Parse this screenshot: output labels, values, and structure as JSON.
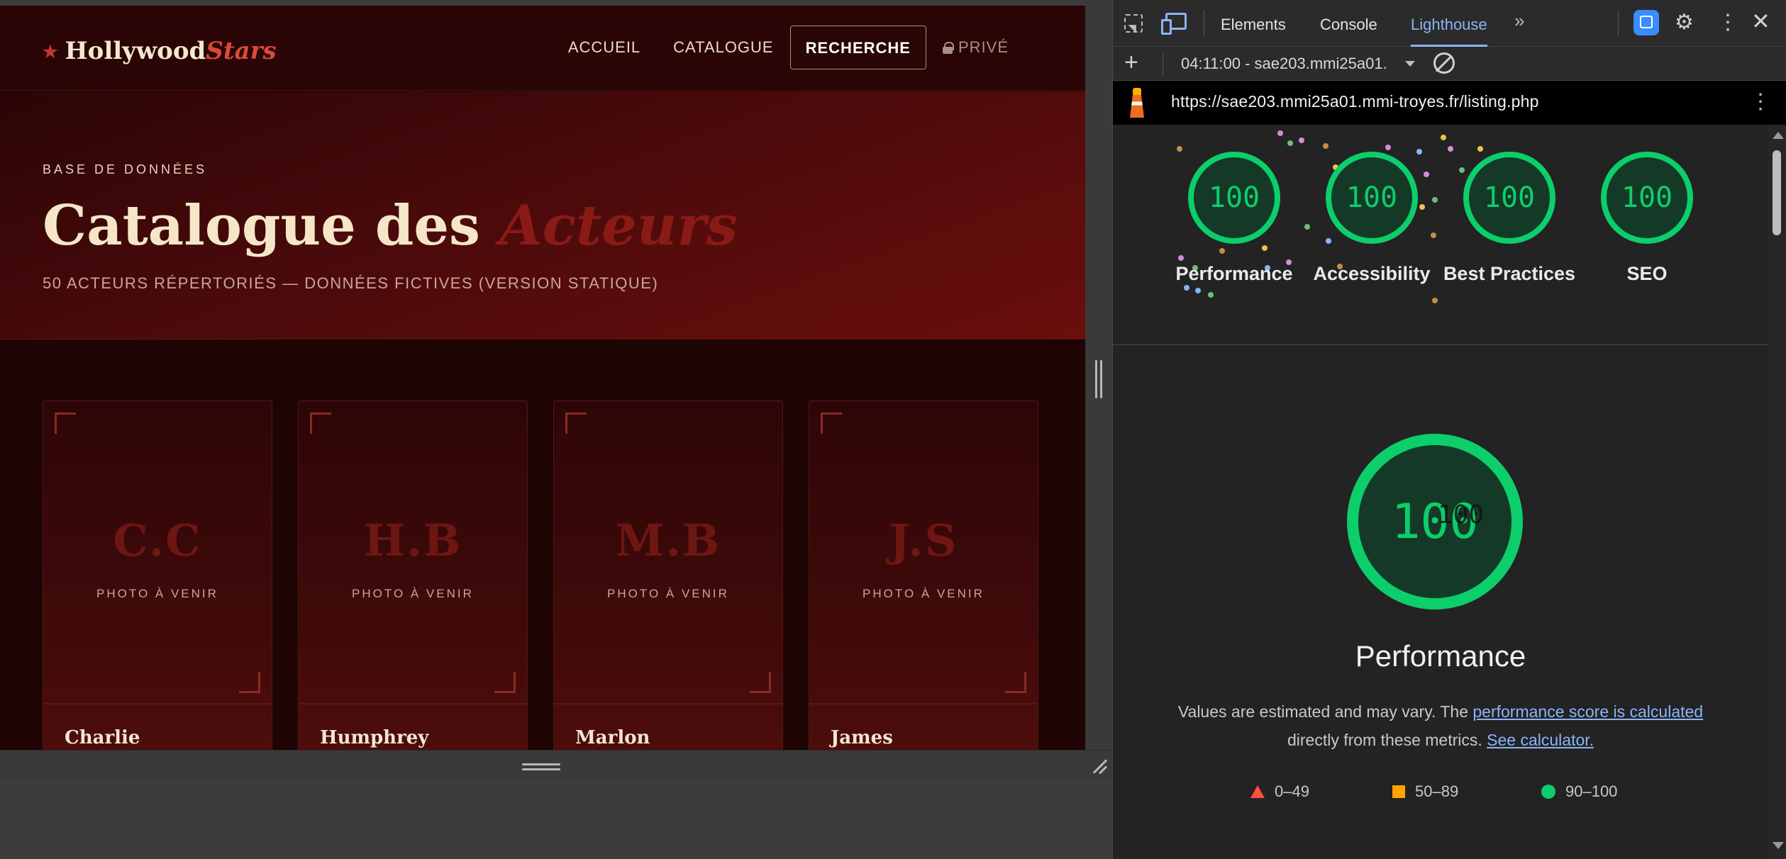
{
  "site": {
    "logo": {
      "main": "Hollywood",
      "accent": "Stars"
    },
    "nav": [
      "ACCUEIL",
      "CATALOGUE",
      "RECHERCHE",
      "PRIVÉ"
    ],
    "hero": {
      "kicker": "BASE DE DONNÉES",
      "title": "Catalogue des",
      "title_accent": "Acteurs",
      "subtitle": "50 ACTEURS RÉPERTORIÉS — DONNÉES FICTIVES (VERSION STATIQUE)"
    },
    "cards": [
      {
        "initials": "C.C",
        "photo": "PHOTO À VENIR",
        "name": "Charlie"
      },
      {
        "initials": "H.B",
        "photo": "PHOTO À VENIR",
        "name": "Humphrey"
      },
      {
        "initials": "M.B",
        "photo": "PHOTO À VENIR",
        "name": "Marlon"
      },
      {
        "initials": "J.S",
        "photo": "PHOTO À VENIR",
        "name": "James"
      }
    ]
  },
  "devtools": {
    "tabs": [
      "Elements",
      "Console",
      "Lighthouse"
    ],
    "report_selector": "04:11:00 - sae203.mmi25a01.",
    "url": "https://sae203.mmi25a01.mmi-troyes.fr/listing.php",
    "scores": [
      {
        "value": "100",
        "label": "Performance"
      },
      {
        "value": "100",
        "label": "Accessibility"
      },
      {
        "value": "100",
        "label": "Best Practices"
      },
      {
        "value": "100",
        "label": "SEO"
      }
    ],
    "performance": {
      "score": "100",
      "title": "Performance",
      "note_before": "Values are estimated and may vary. The",
      "note_link": "performance score is calculated",
      "note_after": "directly from these metrics.",
      "calc_link": "See calculator."
    },
    "legend": [
      "0–49",
      "50–89",
      "90–100"
    ],
    "colors": {
      "pass": "#0cce6b",
      "average": "#ffa400",
      "fail": "#ff4e42",
      "accent": "#8ab4f8"
    }
  }
}
